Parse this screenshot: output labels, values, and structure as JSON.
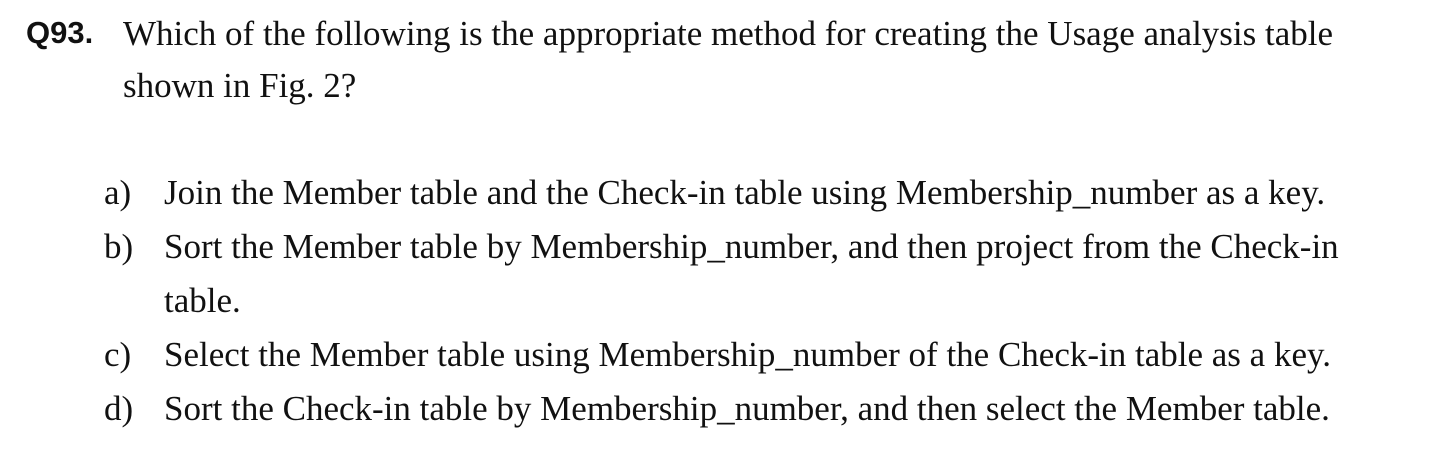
{
  "question": {
    "number": "Q93.",
    "text": "Which of the following is the appropriate method for creating the Usage analysis table shown in Fig. 2?"
  },
  "options": [
    {
      "letter": "a)",
      "text": "Join the Member table and the Check-in table using Membership_number as a key."
    },
    {
      "letter": "b)",
      "text": "Sort the Member table by Membership_number, and then project from the Check-in table."
    },
    {
      "letter": "c)",
      "text": "Select the Member table using Membership_number of the Check-in table as a key."
    },
    {
      "letter": "d)",
      "text": "Sort the Check-in table by Membership_number, and then select the Member table."
    }
  ]
}
